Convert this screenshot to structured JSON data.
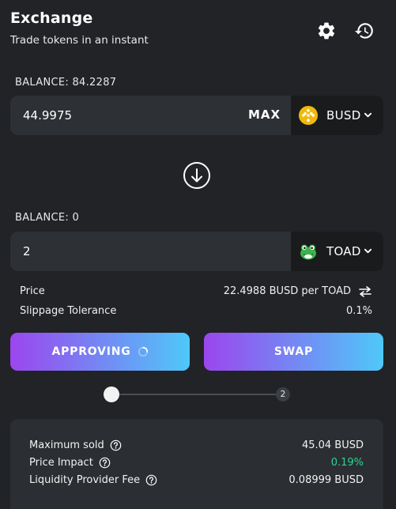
{
  "header": {
    "title": "Exchange",
    "subtitle": "Trade tokens in an instant",
    "settings_icon": "gear-icon",
    "history_icon": "history-icon"
  },
  "from": {
    "balance_label": "BALANCE: 84.2287",
    "amount": "44.9975",
    "max_label": "MAX",
    "token": "BUSD",
    "token_icon": "busd-logo-icon"
  },
  "switch_icon": "arrow-down-circle-icon",
  "to": {
    "balance_label": "BALANCE: 0",
    "amount": "2",
    "token": "TOAD",
    "token_icon": "toad-logo-icon"
  },
  "price": {
    "label": "Price",
    "value": "22.4988 BUSD per TOAD"
  },
  "slippage": {
    "label": "Slippage Tolerance",
    "value": "0.1%"
  },
  "buttons": {
    "approve_label": "APPROVING",
    "swap_label": "SWAP"
  },
  "stepper": {
    "current_step": 1,
    "total_steps": 2,
    "step2_label": "2"
  },
  "summary": {
    "max_sold_label": "Maximum sold",
    "max_sold_value": "45.04 BUSD",
    "impact_label": "Price Impact",
    "impact_value": "0.19%",
    "fee_label": "Liquidity Provider Fee",
    "fee_value": "0.08999 BUSD"
  },
  "colors": {
    "background": "#212326",
    "button_gradient_start": "#9b46ee",
    "button_gradient_end": "#4fc8f9",
    "impact_green": "#2ed492",
    "busd_yellow": "#f0b90b"
  }
}
